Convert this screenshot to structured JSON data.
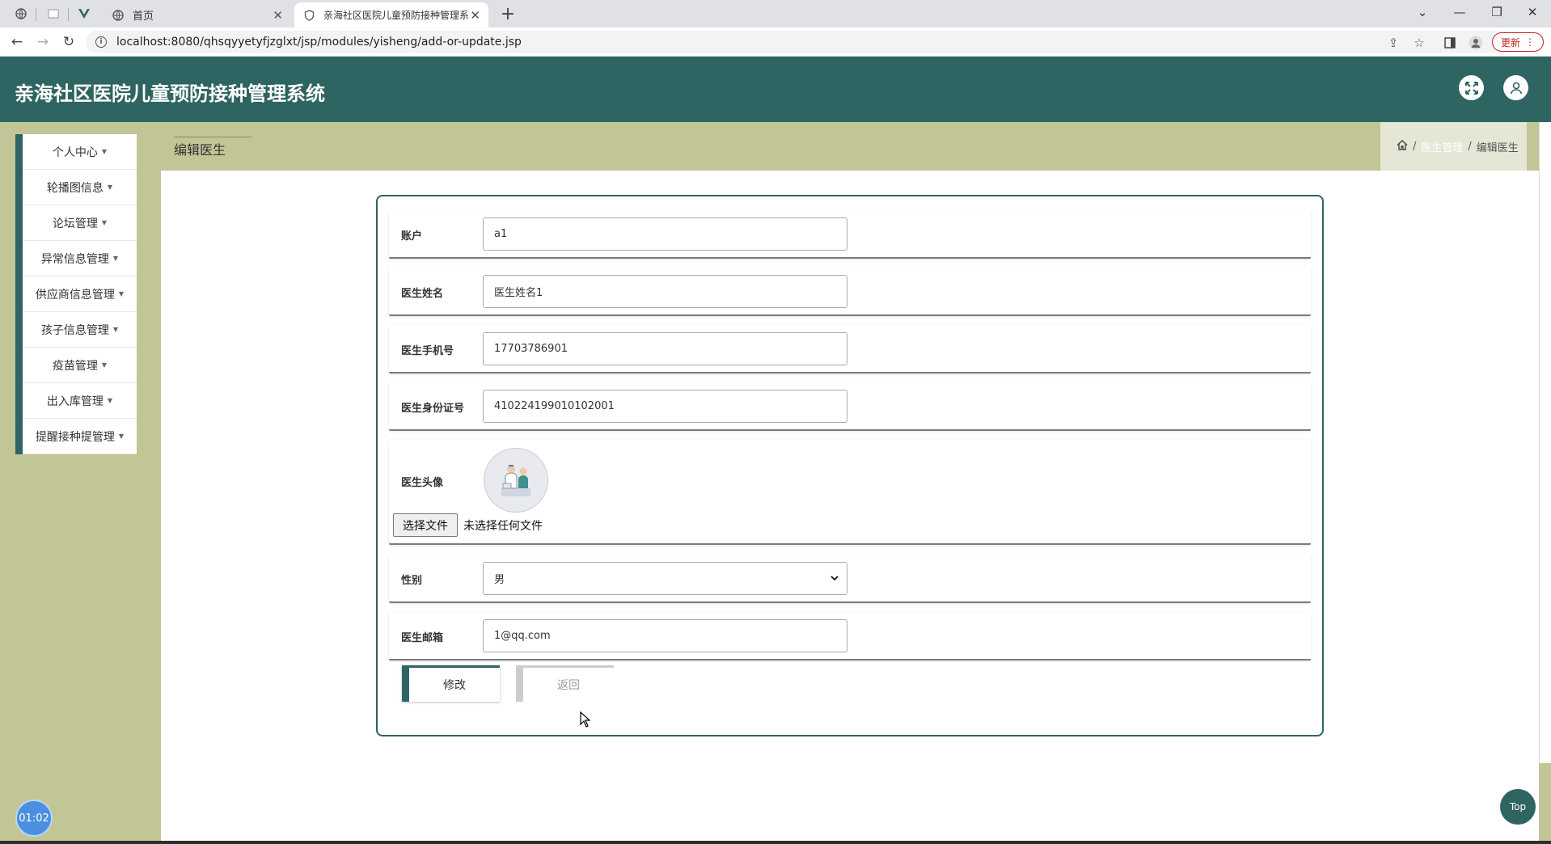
{
  "browser": {
    "tabs": [
      {
        "label": "首页"
      },
      {
        "label": "亲海社区医院儿童预防接种管理系"
      }
    ],
    "url": "localhost:8080/qhsqyyetyfjzglxt/jsp/modules/yisheng/add-or-update.jsp",
    "update_label": "更新"
  },
  "app": {
    "title": "亲海社区医院儿童预防接种管理系统"
  },
  "sidebar": {
    "items": [
      {
        "label": "个人中心"
      },
      {
        "label": "轮播图信息"
      },
      {
        "label": "论坛管理"
      },
      {
        "label": "异常信息管理"
      },
      {
        "label": "供应商信息管理"
      },
      {
        "label": "孩子信息管理"
      },
      {
        "label": "疫苗管理"
      },
      {
        "label": "出入库管理"
      },
      {
        "label": "提醒接种提管理"
      }
    ]
  },
  "page": {
    "title": "编辑医生",
    "breadcrumb": {
      "parent": "医生管理",
      "current": "编辑医生"
    }
  },
  "form": {
    "account": {
      "label": "账户",
      "value": "a1"
    },
    "name": {
      "label": "医生姓名",
      "value": "医生姓名1"
    },
    "phone": {
      "label": "医生手机号",
      "value": "17703786901"
    },
    "id_card": {
      "label": "医生身份证号",
      "value": "410224199010102001"
    },
    "avatar": {
      "label": "医生头像",
      "file_button": "选择文件",
      "file_status": "未选择任何文件"
    },
    "gender": {
      "label": "性别",
      "value": "男"
    },
    "email": {
      "label": "医生邮箱",
      "value": "1@qq.com"
    },
    "submit_label": "修改",
    "back_label": "返回"
  },
  "widgets": {
    "top_label": "Top",
    "timer": "01:02"
  },
  "colors": {
    "primary": "#2e6461",
    "background": "#c2c596"
  }
}
